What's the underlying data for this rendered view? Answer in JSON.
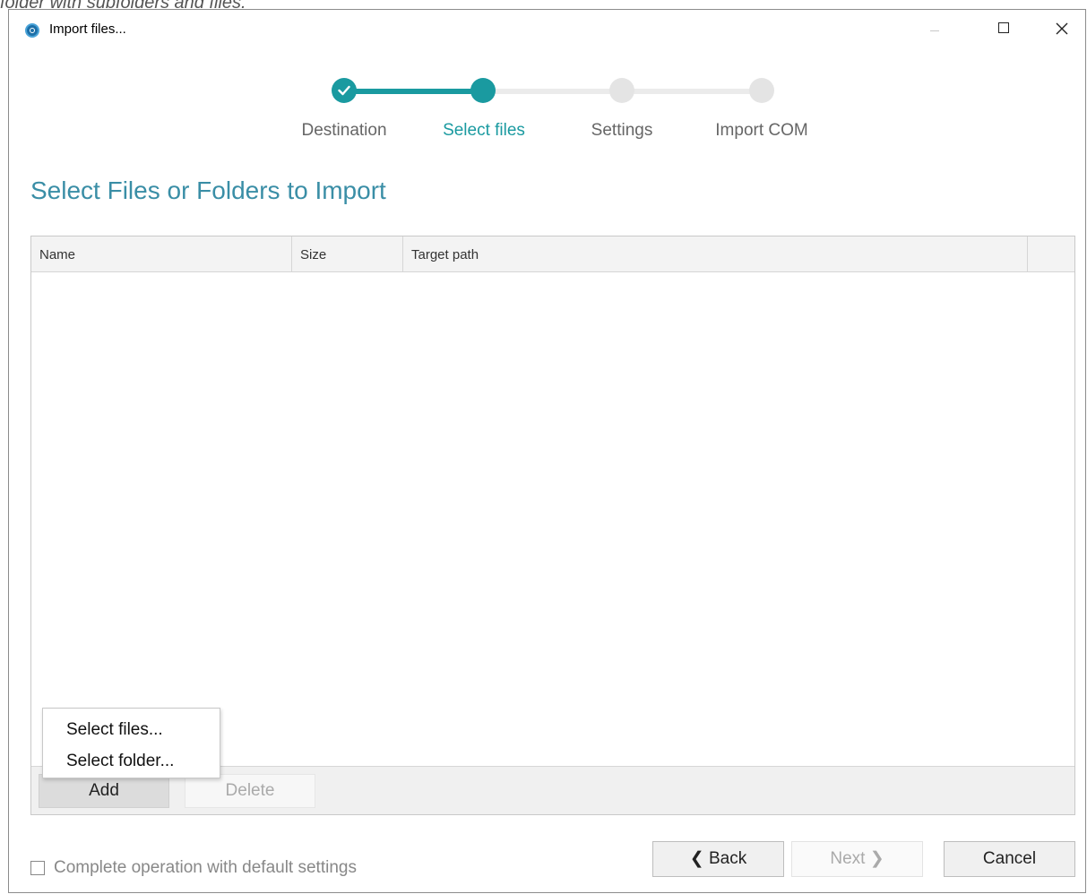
{
  "caption": "folder with subfolders and files.",
  "window": {
    "title": "Import files...",
    "icon": "app-logo-icon",
    "controls": [
      "minimize-icon",
      "maximize-icon",
      "close-icon"
    ]
  },
  "stepper": {
    "steps": [
      {
        "label": "Destination",
        "state": "completed"
      },
      {
        "label": "Select files",
        "state": "active"
      },
      {
        "label": "Settings",
        "state": "pending"
      },
      {
        "label": "Import COM",
        "state": "pending"
      }
    ],
    "accent_color": "#1a9aa0"
  },
  "page": {
    "heading": "Select Files or Folders to Import"
  },
  "table": {
    "columns": [
      "Name",
      "Size",
      "Target path",
      ""
    ],
    "rows": [],
    "buttons": {
      "add": "Add",
      "delete": "Delete"
    }
  },
  "add_menu": {
    "items": [
      "Select files...",
      "Select folder..."
    ]
  },
  "footer": {
    "default_settings_label": "Complete operation with default settings",
    "default_settings_checked": false,
    "back_label": "Back",
    "next_label": "Next",
    "cancel_label": "Cancel"
  }
}
